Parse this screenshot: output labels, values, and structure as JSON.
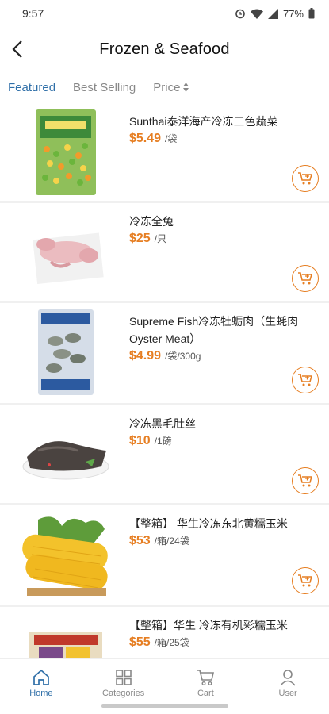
{
  "status": {
    "time": "9:57",
    "battery": "77%"
  },
  "header": {
    "title": "Frozen & Seafood"
  },
  "sort": {
    "featured": "Featured",
    "best_selling": "Best Selling",
    "price": "Price"
  },
  "products": [
    {
      "name": "Sunthai泰洋海产冷冻三色蔬菜",
      "price": "$5.49",
      "unit": "/袋"
    },
    {
      "name": "冷冻全兔",
      "price": "$25",
      "unit": "/只"
    },
    {
      "name": "Supreme Fish冷冻牡蛎肉（生蚝肉 Oyster Meat）",
      "price": "$4.99",
      "unit": "/袋/300g"
    },
    {
      "name": "冷冻黑毛肚丝",
      "price": "$10",
      "unit": "/1磅"
    },
    {
      "name": "【整箱】 华生冷冻东北黄糯玉米",
      "price": "$53",
      "unit": "/箱/24袋"
    },
    {
      "name": "【整箱】华生 冷冻有机彩糯玉米",
      "price": "$55",
      "unit": "/箱/25袋"
    }
  ],
  "nav": {
    "home": "Home",
    "categories": "Categories",
    "cart": "Cart",
    "user": "User"
  },
  "colors": {
    "accent": "#2f6fa8",
    "price": "#e67e22"
  }
}
